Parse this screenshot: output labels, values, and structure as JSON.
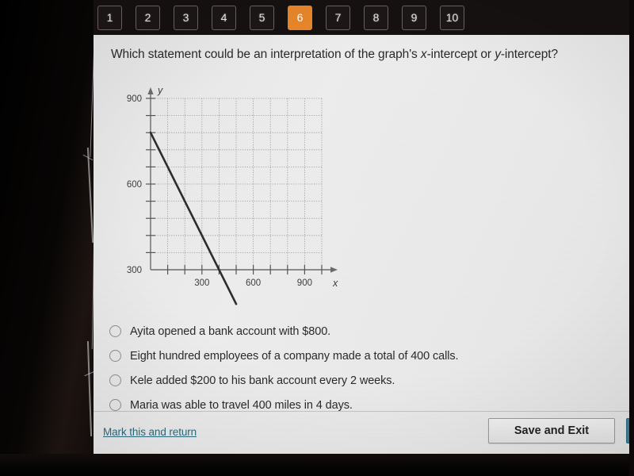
{
  "nav": {
    "tabs": [
      {
        "label": "1",
        "active": false
      },
      {
        "label": "2",
        "active": false
      },
      {
        "label": "3",
        "active": false
      },
      {
        "label": "4",
        "active": false
      },
      {
        "label": "5",
        "active": false
      },
      {
        "label": "6",
        "active": true
      },
      {
        "label": "7",
        "active": false
      },
      {
        "label": "8",
        "active": false
      },
      {
        "label": "9",
        "active": false
      },
      {
        "label": "10",
        "active": false
      }
    ],
    "active_color": "#e8862a",
    "tab_border_color": "#8a5a33",
    "tab_background": "#1c1716"
  },
  "question": {
    "text_before_x": "Which statement could be an interpretation of the graph's ",
    "x_symbol": "x",
    "text_middle": "-intercept or ",
    "y_symbol": "y",
    "text_after": "-intercept?",
    "full_text": "Which statement could be an interpretation of the graph's x-intercept or y-intercept?"
  },
  "chart_data": {
    "type": "line",
    "title": "",
    "xlabel": "x",
    "ylabel": "y",
    "xlim": [
      0,
      1000
    ],
    "ylim": [
      0,
      1000
    ],
    "xticks_labeled": [
      300,
      600,
      900
    ],
    "yticks_labeled": [
      300,
      600,
      900
    ],
    "tick_interval": 100,
    "grid": true,
    "grid_style": "dotted",
    "grid_color": "#9a9a9a",
    "line_color": "#2c2c2c",
    "series": [
      {
        "name": "line",
        "x": [
          0,
          500
        ],
        "y": [
          800,
          -200
        ],
        "x_intercept": 400,
        "y_intercept": 800,
        "slope": -2
      }
    ],
    "axis_arrows": true
  },
  "options": [
    {
      "id": "a",
      "label": "Ayita opened a bank account with $800.",
      "selected": false
    },
    {
      "id": "b",
      "label": "Eight hundred employees of a company made a total of 400 calls.",
      "selected": false
    },
    {
      "id": "c",
      "label": "Kele added $200 to his bank account every 2 weeks.",
      "selected": false
    },
    {
      "id": "d",
      "label": "Maria was able to travel 400 miles in 4 days.",
      "selected": false
    }
  ],
  "footer": {
    "mark_link": "Mark this and return",
    "mark_link_color": "#2a6a7c",
    "save_button": "Save and Exit",
    "next_button": ""
  },
  "colors": {
    "page_background": "#e9e9e9",
    "text": "#27292c",
    "bezel": "#0b0807"
  }
}
